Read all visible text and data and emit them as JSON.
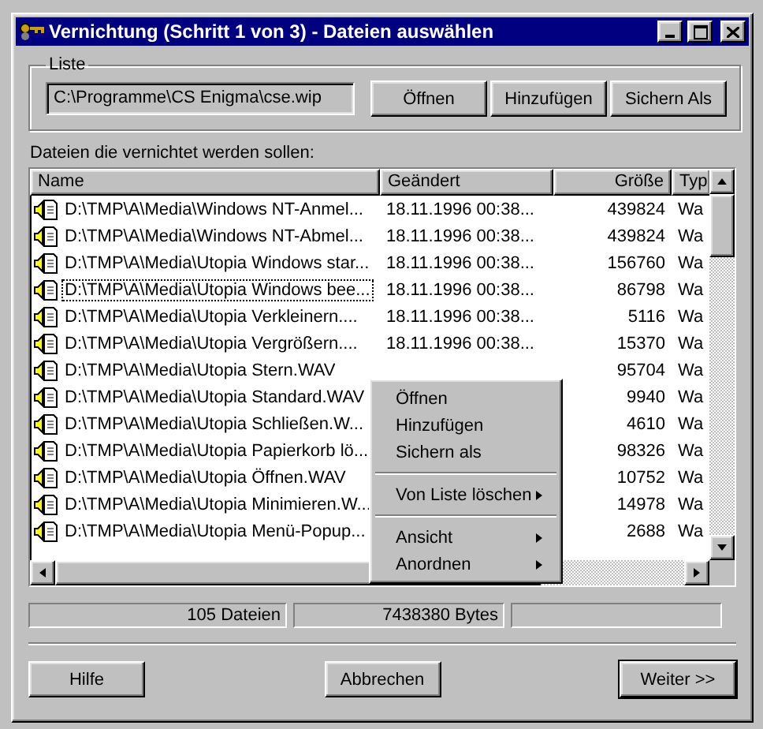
{
  "window": {
    "title": "Vernichtung (Schritt 1 von 3) - Dateien auswählen"
  },
  "list_group": {
    "label": "Liste",
    "path": "C:\\Programme\\CS Enigma\\cse.wip",
    "buttons": [
      "Öffnen",
      "Hinzufügen",
      "Sichern Als"
    ]
  },
  "files_label": "Dateien die vernichtet werden sollen:",
  "table": {
    "columns": [
      "Name",
      "Geändert",
      "Größe",
      "Typ"
    ],
    "rows": [
      {
        "name": "D:\\TMP\\A\\Media\\Windows NT-Anmel...",
        "changed": "18.11.1996  00:38...",
        "size": "439824",
        "type": "Wa",
        "focused": false
      },
      {
        "name": "D:\\TMP\\A\\Media\\Windows NT-Abmel...",
        "changed": "18.11.1996  00:38...",
        "size": "439824",
        "type": "Wa",
        "focused": false
      },
      {
        "name": "D:\\TMP\\A\\Media\\Utopia Windows star...",
        "changed": "18.11.1996  00:38...",
        "size": "156760",
        "type": "Wa",
        "focused": false
      },
      {
        "name": "D:\\TMP\\A\\Media\\Utopia Windows bee...",
        "changed": "18.11.1996  00:38...",
        "size": "86798",
        "type": "Wa",
        "focused": true
      },
      {
        "name": "D:\\TMP\\A\\Media\\Utopia Verkleinern....",
        "changed": "18.11.1996  00:38...",
        "size": "5116",
        "type": "Wa",
        "focused": false
      },
      {
        "name": "D:\\TMP\\A\\Media\\Utopia Vergrößern....",
        "changed": "18.11.1996  00:38...",
        "size": "15370",
        "type": "Wa",
        "focused": false
      },
      {
        "name": "D:\\TMP\\A\\Media\\Utopia Stern.WAV",
        "size": "95704",
        "type": "Wa",
        "focused": false
      },
      {
        "name": "D:\\TMP\\A\\Media\\Utopia Standard.WAV",
        "size": "9940",
        "type": "Wa",
        "focused": false
      },
      {
        "name": "D:\\TMP\\A\\Media\\Utopia Schließen.W...",
        "size": "4610",
        "type": "Wa",
        "focused": false
      },
      {
        "name": "D:\\TMP\\A\\Media\\Utopia Papierkorb lö...",
        "size": "98326",
        "type": "Wa",
        "focused": false
      },
      {
        "name": "D:\\TMP\\A\\Media\\Utopia Öffnen.WAV",
        "size": "10752",
        "type": "Wa",
        "focused": false
      },
      {
        "name": "D:\\TMP\\A\\Media\\Utopia Minimieren.W...",
        "size": "14978",
        "type": "Wa",
        "focused": false
      },
      {
        "name": "D:\\TMP\\A\\Media\\Utopia Menü-Popup...",
        "size": "2688",
        "type": "Wa",
        "focused": false
      }
    ]
  },
  "context_menu": [
    {
      "kind": "item",
      "label": "Öffnen",
      "submenu": false
    },
    {
      "kind": "item",
      "label": "Hinzufügen",
      "submenu": false
    },
    {
      "kind": "item",
      "label": "Sichern als",
      "submenu": false
    },
    {
      "kind": "separator"
    },
    {
      "kind": "item",
      "label": "Von Liste löschen",
      "submenu": true
    },
    {
      "kind": "separator"
    },
    {
      "kind": "item",
      "label": "Ansicht",
      "submenu": true
    },
    {
      "kind": "item",
      "label": "Anordnen",
      "submenu": true
    }
  ],
  "status_bar": [
    "105 Dateien",
    "7438380 Bytes"
  ],
  "buttons": [
    {
      "label": "Hilfe",
      "default": false
    },
    {
      "label": "Abbrechen",
      "default": false
    },
    {
      "label": "Weiter >>",
      "default": true
    }
  ]
}
